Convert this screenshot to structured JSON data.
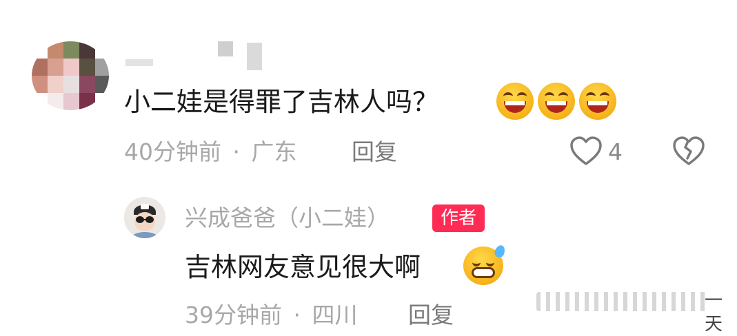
{
  "comment": {
    "author_name": "",
    "text": "小二娃是得罪了吉林人吗？",
    "emoji": "laughing-face-icon",
    "time": "40分钟前",
    "separator": "·",
    "location": "广东",
    "reply_label": "回复",
    "like_count": "4"
  },
  "reply": {
    "author_name": "兴成爸爸（小二娃）",
    "author_badge": "作者",
    "text": "吉林网友意见很大啊",
    "emoji": "grinning-sweat-icon",
    "time": "39分钟前",
    "separator": "·",
    "location": "四川",
    "reply_label": "回复"
  },
  "watermark": {
    "text": "一天"
  },
  "colors": {
    "primary_text": "#1a1a1a",
    "secondary_text": "#a8a8a8",
    "author_badge": "#fe2c55"
  }
}
